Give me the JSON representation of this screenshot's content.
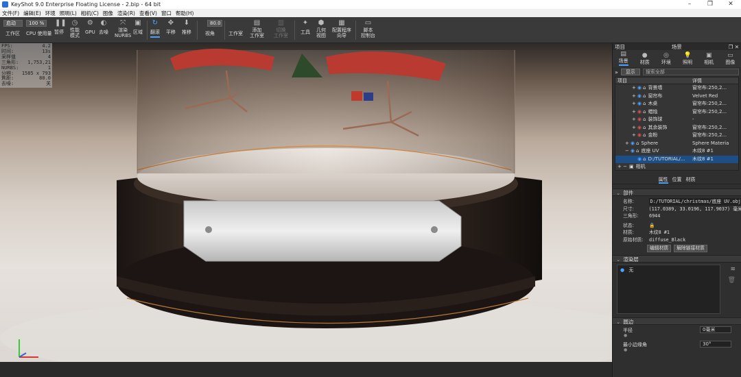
{
  "window": {
    "title": "KeyShot 9.0 Enterprise Floating License  - 2.bip  - 64 bit"
  },
  "menu": [
    "文件(F)",
    "编辑(E)",
    "环境",
    "照明(L)",
    "相机(C)",
    "图像",
    "渲染(R)",
    "查看(V)",
    "窗口",
    "帮助(H)"
  ],
  "toolbar": {
    "startup_value": "启动",
    "zoom_value": "100 %",
    "fov_value": "80.0",
    "items": {
      "workspace": "工作区",
      "cpu": "CPU 使用量",
      "pause": "暂停",
      "perf1": "性能",
      "perf2": "模式",
      "gpu": "GPU",
      "denoise": "去噪",
      "render_nurbs1": "渲染",
      "render_nurbs2": "NURBS",
      "region": "区域",
      "tumble": "翻滚",
      "pan": "平移",
      "dolly": "推移",
      "view": "视角",
      "studio": "工作室",
      "add_studio1": "添加",
      "add_studio2": "工作室",
      "switch_studio1": "切换",
      "switch_studio2": "工作室",
      "tools": "工具",
      "geom1": "几何",
      "geom2": "视图",
      "config1": "配置程序",
      "config2": "向导",
      "script1": "脚本",
      "script2": "控制台"
    }
  },
  "hud": [
    {
      "k": "FPS:",
      "v": "4.2"
    },
    {
      "k": "时间:",
      "v": "13s"
    },
    {
      "k": "采样值",
      "v": "4"
    },
    {
      "k": "三角形:",
      "v": "1,753,21"
    },
    {
      "k": "NURBS:",
      "v": "1"
    },
    {
      "k": "分辨:",
      "v": "1585 x 793"
    },
    {
      "k": "焦距:",
      "v": "80.0"
    },
    {
      "k": "去噪:",
      "v": "关"
    }
  ],
  "panel": {
    "left_label": "项目",
    "title": "场景",
    "tabs": [
      "场景",
      "材质",
      "环境",
      "照明",
      "相机",
      "图像"
    ],
    "show_button": "显示",
    "search_placeholder": "搜索全部",
    "col_item": "项目",
    "col_detail": "详情",
    "rows": [
      {
        "name": "背景墙",
        "detail": "窗帘布:250,2..."
      },
      {
        "name": "窗帘布",
        "detail": "Velvet Red"
      },
      {
        "name": "木桌",
        "detail": "窗帘布:250,2..."
      },
      {
        "name": "蜡烛",
        "detail": "窗帘布:250,2..."
      },
      {
        "name": "装饰球",
        "detail": "-"
      },
      {
        "name": "其余装饰",
        "detail": "窗帘布:250,2..."
      },
      {
        "name": "金粉",
        "detail": "窗帘布:250,2..."
      },
      {
        "name": "Sphere",
        "detail": "Sphere Materia"
      },
      {
        "name": "底座 UV",
        "detail": "木纹8 #1"
      },
      {
        "name": "D:/TUTORIAL/...",
        "detail": "木纹8 #1"
      },
      {
        "name": "相机",
        "detail": ""
      }
    ],
    "sub_tabs": [
      "属性",
      "位置",
      "材质"
    ],
    "sections": {
      "parts": "部件",
      "layers": "渲染层",
      "rounding": "圆边"
    },
    "props": [
      {
        "k": "名称:",
        "v": "D:/TUTORIAL/christmas/底座 UV.obj"
      },
      {
        "k": "尺寸:",
        "v": "(117.0389, 33.0196, 117.9037) 毫米"
      },
      {
        "k": "三角形:",
        "v": "6944"
      },
      {
        "k": "状态:",
        "v": ""
      },
      {
        "k": "材质:",
        "v": "木纹8 #1"
      },
      {
        "k": "原始材质:",
        "v": "diffuse_Black"
      }
    ],
    "edit_material": "编辑材质",
    "unlink_material": "解除链接材质",
    "layer_item": "无",
    "radius_label": "半径",
    "radius_value": "0毫米",
    "min_angle_label": "最小边缘角",
    "min_angle_value": "30°"
  }
}
